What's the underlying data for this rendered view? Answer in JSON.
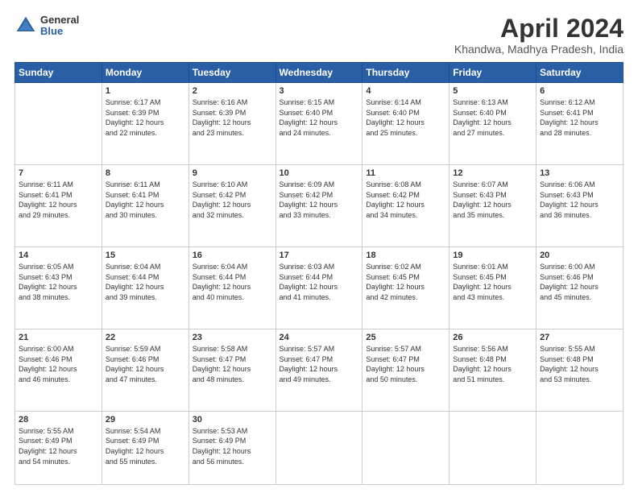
{
  "logo": {
    "general": "General",
    "blue": "Blue"
  },
  "header": {
    "title": "April 2024",
    "subtitle": "Khandwa, Madhya Pradesh, India"
  },
  "weekdays": [
    "Sunday",
    "Monday",
    "Tuesday",
    "Wednesday",
    "Thursday",
    "Friday",
    "Saturday"
  ],
  "weeks": [
    [
      {
        "day": "",
        "info": ""
      },
      {
        "day": "1",
        "info": "Sunrise: 6:17 AM\nSunset: 6:39 PM\nDaylight: 12 hours\nand 22 minutes."
      },
      {
        "day": "2",
        "info": "Sunrise: 6:16 AM\nSunset: 6:39 PM\nDaylight: 12 hours\nand 23 minutes."
      },
      {
        "day": "3",
        "info": "Sunrise: 6:15 AM\nSunset: 6:40 PM\nDaylight: 12 hours\nand 24 minutes."
      },
      {
        "day": "4",
        "info": "Sunrise: 6:14 AM\nSunset: 6:40 PM\nDaylight: 12 hours\nand 25 minutes."
      },
      {
        "day": "5",
        "info": "Sunrise: 6:13 AM\nSunset: 6:40 PM\nDaylight: 12 hours\nand 27 minutes."
      },
      {
        "day": "6",
        "info": "Sunrise: 6:12 AM\nSunset: 6:41 PM\nDaylight: 12 hours\nand 28 minutes."
      }
    ],
    [
      {
        "day": "7",
        "info": "Sunrise: 6:11 AM\nSunset: 6:41 PM\nDaylight: 12 hours\nand 29 minutes."
      },
      {
        "day": "8",
        "info": "Sunrise: 6:11 AM\nSunset: 6:41 PM\nDaylight: 12 hours\nand 30 minutes."
      },
      {
        "day": "9",
        "info": "Sunrise: 6:10 AM\nSunset: 6:42 PM\nDaylight: 12 hours\nand 32 minutes."
      },
      {
        "day": "10",
        "info": "Sunrise: 6:09 AM\nSunset: 6:42 PM\nDaylight: 12 hours\nand 33 minutes."
      },
      {
        "day": "11",
        "info": "Sunrise: 6:08 AM\nSunset: 6:42 PM\nDaylight: 12 hours\nand 34 minutes."
      },
      {
        "day": "12",
        "info": "Sunrise: 6:07 AM\nSunset: 6:43 PM\nDaylight: 12 hours\nand 35 minutes."
      },
      {
        "day": "13",
        "info": "Sunrise: 6:06 AM\nSunset: 6:43 PM\nDaylight: 12 hours\nand 36 minutes."
      }
    ],
    [
      {
        "day": "14",
        "info": "Sunrise: 6:05 AM\nSunset: 6:43 PM\nDaylight: 12 hours\nand 38 minutes."
      },
      {
        "day": "15",
        "info": "Sunrise: 6:04 AM\nSunset: 6:44 PM\nDaylight: 12 hours\nand 39 minutes."
      },
      {
        "day": "16",
        "info": "Sunrise: 6:04 AM\nSunset: 6:44 PM\nDaylight: 12 hours\nand 40 minutes."
      },
      {
        "day": "17",
        "info": "Sunrise: 6:03 AM\nSunset: 6:44 PM\nDaylight: 12 hours\nand 41 minutes."
      },
      {
        "day": "18",
        "info": "Sunrise: 6:02 AM\nSunset: 6:45 PM\nDaylight: 12 hours\nand 42 minutes."
      },
      {
        "day": "19",
        "info": "Sunrise: 6:01 AM\nSunset: 6:45 PM\nDaylight: 12 hours\nand 43 minutes."
      },
      {
        "day": "20",
        "info": "Sunrise: 6:00 AM\nSunset: 6:46 PM\nDaylight: 12 hours\nand 45 minutes."
      }
    ],
    [
      {
        "day": "21",
        "info": "Sunrise: 6:00 AM\nSunset: 6:46 PM\nDaylight: 12 hours\nand 46 minutes."
      },
      {
        "day": "22",
        "info": "Sunrise: 5:59 AM\nSunset: 6:46 PM\nDaylight: 12 hours\nand 47 minutes."
      },
      {
        "day": "23",
        "info": "Sunrise: 5:58 AM\nSunset: 6:47 PM\nDaylight: 12 hours\nand 48 minutes."
      },
      {
        "day": "24",
        "info": "Sunrise: 5:57 AM\nSunset: 6:47 PM\nDaylight: 12 hours\nand 49 minutes."
      },
      {
        "day": "25",
        "info": "Sunrise: 5:57 AM\nSunset: 6:47 PM\nDaylight: 12 hours\nand 50 minutes."
      },
      {
        "day": "26",
        "info": "Sunrise: 5:56 AM\nSunset: 6:48 PM\nDaylight: 12 hours\nand 51 minutes."
      },
      {
        "day": "27",
        "info": "Sunrise: 5:55 AM\nSunset: 6:48 PM\nDaylight: 12 hours\nand 53 minutes."
      }
    ],
    [
      {
        "day": "28",
        "info": "Sunrise: 5:55 AM\nSunset: 6:49 PM\nDaylight: 12 hours\nand 54 minutes."
      },
      {
        "day": "29",
        "info": "Sunrise: 5:54 AM\nSunset: 6:49 PM\nDaylight: 12 hours\nand 55 minutes."
      },
      {
        "day": "30",
        "info": "Sunrise: 5:53 AM\nSunset: 6:49 PM\nDaylight: 12 hours\nand 56 minutes."
      },
      {
        "day": "",
        "info": ""
      },
      {
        "day": "",
        "info": ""
      },
      {
        "day": "",
        "info": ""
      },
      {
        "day": "",
        "info": ""
      }
    ]
  ]
}
